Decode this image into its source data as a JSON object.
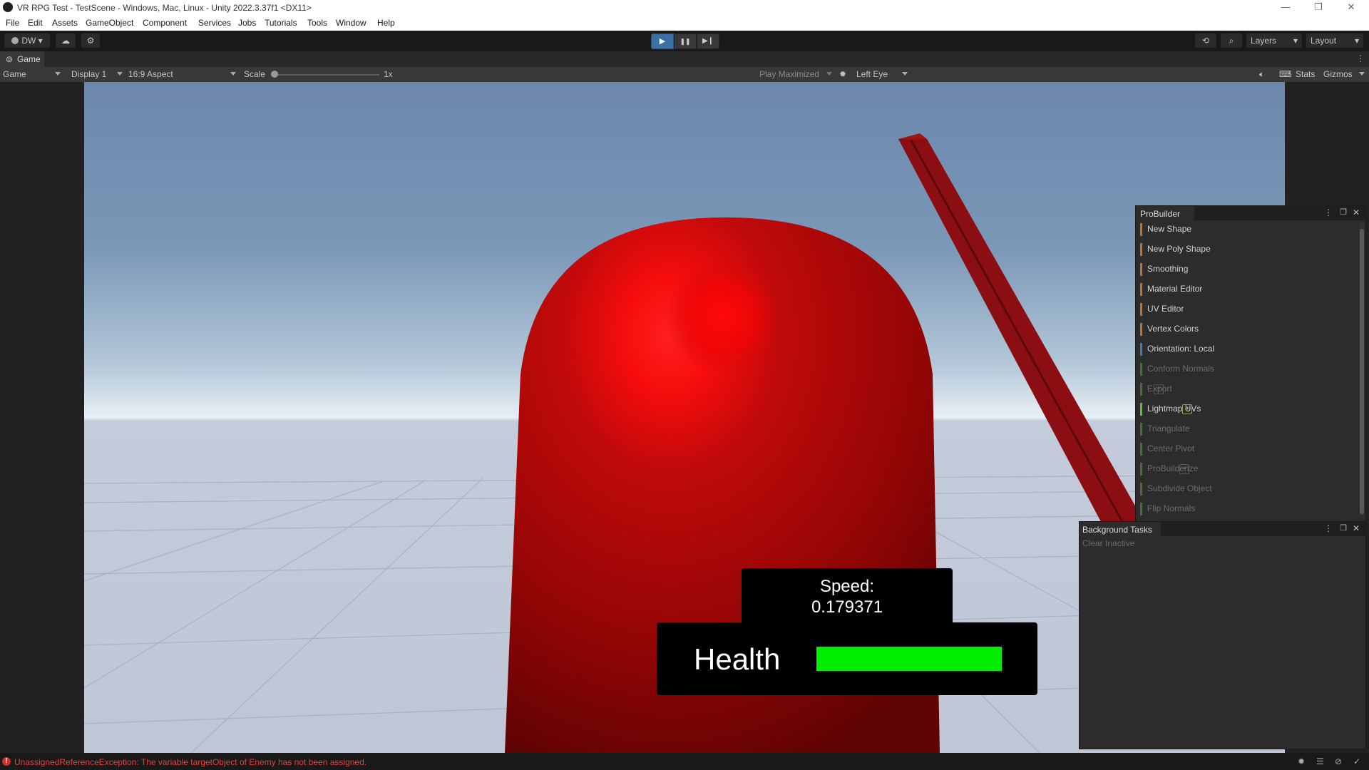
{
  "window": {
    "title": "VR RPG Test - TestScene - Windows, Mac, Linux - Unity 2022.3.37f1 <DX11>",
    "minimize": "—",
    "maximize": "❐",
    "close": "✕"
  },
  "menu": [
    "File",
    "Edit",
    "Assets",
    "GameObject",
    "Component",
    "Services",
    "Jobs",
    "Tutorials",
    "Tools",
    "Window",
    "Help"
  ],
  "toolbar": {
    "account_label": "DW",
    "layers_label": "Layers",
    "layout_label": "Layout",
    "play_icon": "▶",
    "pause_icon": "❚❚",
    "step_icon": "▶❙"
  },
  "game_tab": {
    "label": "Game"
  },
  "game_toolbar": {
    "mode": "Game",
    "display": "Display 1",
    "aspect": "16:9 Aspect",
    "scale_label": "Scale",
    "scale_value": "1x",
    "scale_fraction": 0.0,
    "play_maximized": "Play Maximized",
    "eye": "Left Eye",
    "stats": "Stats",
    "gizmos": "Gizmos"
  },
  "hud": {
    "speed_label": "Speed:",
    "speed_value": "0.179371",
    "health_label": "Health",
    "health_fraction": 1.0,
    "health_color": "#00ee00"
  },
  "probuilder": {
    "title": "ProBuilder",
    "items": [
      {
        "label": "New Shape",
        "color": "#b8743c",
        "enabled": true,
        "plus": false
      },
      {
        "label": "New Poly Shape",
        "color": "#b8743c",
        "enabled": true,
        "plus": false
      },
      {
        "label": "Smoothing",
        "color": "#b8743c",
        "enabled": true,
        "plus": false
      },
      {
        "label": "Material Editor",
        "color": "#b8743c",
        "enabled": true,
        "plus": false
      },
      {
        "label": "UV Editor",
        "color": "#b8743c",
        "enabled": true,
        "plus": false
      },
      {
        "label": "Vertex Colors",
        "color": "#b8743c",
        "enabled": true,
        "plus": false
      },
      {
        "label": "Orientation: Local",
        "color": "#3c7ab8",
        "enabled": true,
        "plus": false
      },
      {
        "label": "Conform Normals",
        "color": "#4a6b3a",
        "enabled": false,
        "plus": false
      },
      {
        "label": "Export",
        "color": "#4a6b3a",
        "enabled": false,
        "plus": true
      },
      {
        "label": "Lightmap UVs",
        "color": "#6bb83c",
        "enabled": true,
        "plus": true
      },
      {
        "label": "Triangulate",
        "color": "#4a6b3a",
        "enabled": false,
        "plus": false
      },
      {
        "label": "Center Pivot",
        "color": "#4a6b3a",
        "enabled": false,
        "plus": false
      },
      {
        "label": "ProBuilderize",
        "color": "#4a6b3a",
        "enabled": false,
        "plus": true
      },
      {
        "label": "Subdivide Object",
        "color": "#4a6b3a",
        "enabled": false,
        "plus": false
      },
      {
        "label": "Flip Normals",
        "color": "#4a6b3a",
        "enabled": false,
        "plus": false
      }
    ]
  },
  "background_tasks": {
    "title": "Background Tasks",
    "clear_label": "Clear Inactive"
  },
  "status": {
    "message": "UnassignedReferenceException: The variable targetObject of Enemy has not been assigned.",
    "color": "#e04040"
  }
}
